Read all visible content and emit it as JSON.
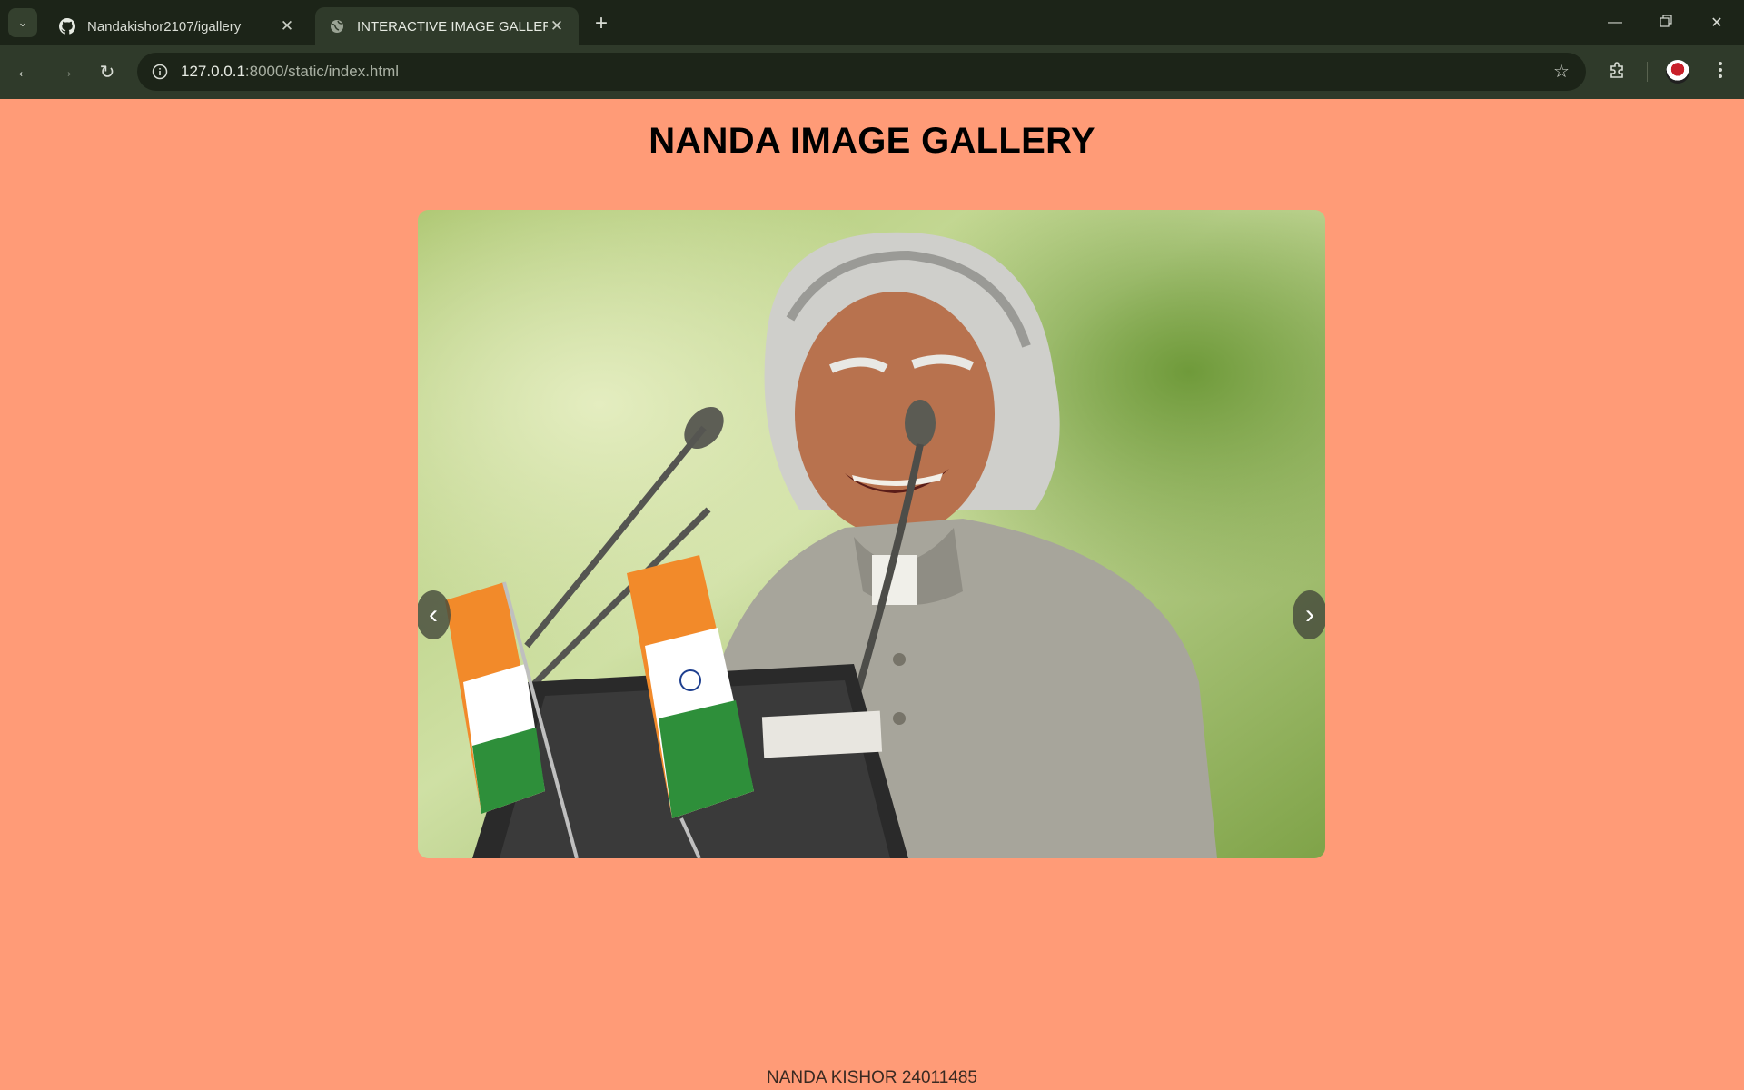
{
  "browser": {
    "tabs": [
      {
        "title": "Nandakishor2107/igallery",
        "icon": "github-icon",
        "active": false
      },
      {
        "title": "INTERACTIVE IMAGE GALLERY",
        "icon": "globe-icon",
        "active": true
      }
    ],
    "url": {
      "host": "127.0.0.1",
      "rest": ":8000/static/index.html"
    }
  },
  "page": {
    "title": "NANDA IMAGE GALLERY",
    "prev_label": "‹",
    "next_label": "›",
    "footer": "NANDA KISHOR 24011485"
  },
  "colors": {
    "page_background": "#ff9b77",
    "chrome_dark": "#1c2418",
    "chrome_toolbar": "#2f3a2a"
  }
}
